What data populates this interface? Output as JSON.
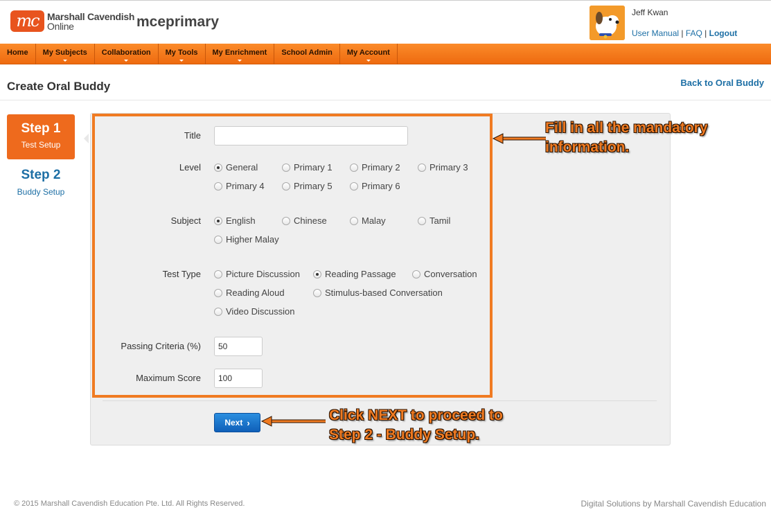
{
  "header": {
    "logo_mark": "mc",
    "logo_line1": "Marshall Cavendish",
    "logo_line2": "Online",
    "site_name": "mceprimary",
    "user_name": "Jeff Kwan",
    "links": {
      "manual": "User Manual",
      "sep1": " | ",
      "faq": "FAQ",
      "sep2": " | ",
      "logout": "Logout"
    }
  },
  "nav": {
    "items": [
      "Home",
      "My Subjects",
      "Collaboration",
      "My Tools",
      "My Enrichment",
      "School Admin",
      "My Account"
    ]
  },
  "page": {
    "title": "Create Oral Buddy",
    "back_link": "Back to Oral Buddy"
  },
  "steps": {
    "step1_num": "Step 1",
    "step1_label": "Test Setup",
    "step2_num": "Step 2",
    "step2_label": "Buddy Setup"
  },
  "form": {
    "title_label": "Title",
    "title_value": "",
    "level_label": "Level",
    "levels": [
      "General",
      "Primary 1",
      "Primary 2",
      "Primary 3",
      "Primary 4",
      "Primary 5",
      "Primary 6"
    ],
    "level_selected": "General",
    "subject_label": "Subject",
    "subjects": [
      "English",
      "Chinese",
      "Malay",
      "Tamil",
      "Higher Malay"
    ],
    "subject_selected": "English",
    "test_type_label": "Test Type",
    "test_types": [
      "Picture Discussion",
      "Reading Passage",
      "Conversation",
      "Reading Aloud",
      "Stimulus-based Conversation",
      "Video Discussion"
    ],
    "test_type_selected": "Reading Passage",
    "passing_label": "Passing Criteria (%)",
    "passing_value": "50",
    "max_score_label": "Maximum Score",
    "max_score_value": "100",
    "next_label": "Next"
  },
  "annotations": {
    "fill_line1": "Fill in all the mandatory",
    "fill_line2": "information.",
    "next_line1": "Click NEXT to proceed to",
    "next_line2": "Step 2 - Buddy Setup."
  },
  "footer": {
    "copyright": "© 2015 Marshall Cavendish Education Pte. Ltd. All Rights Reserved.",
    "credit": "Digital Solutions by Marshall Cavendish Education"
  },
  "colors": {
    "brand_orange": "#ee6a1d",
    "link_blue": "#1d6fa5",
    "button_blue": "#0f5fb8"
  }
}
